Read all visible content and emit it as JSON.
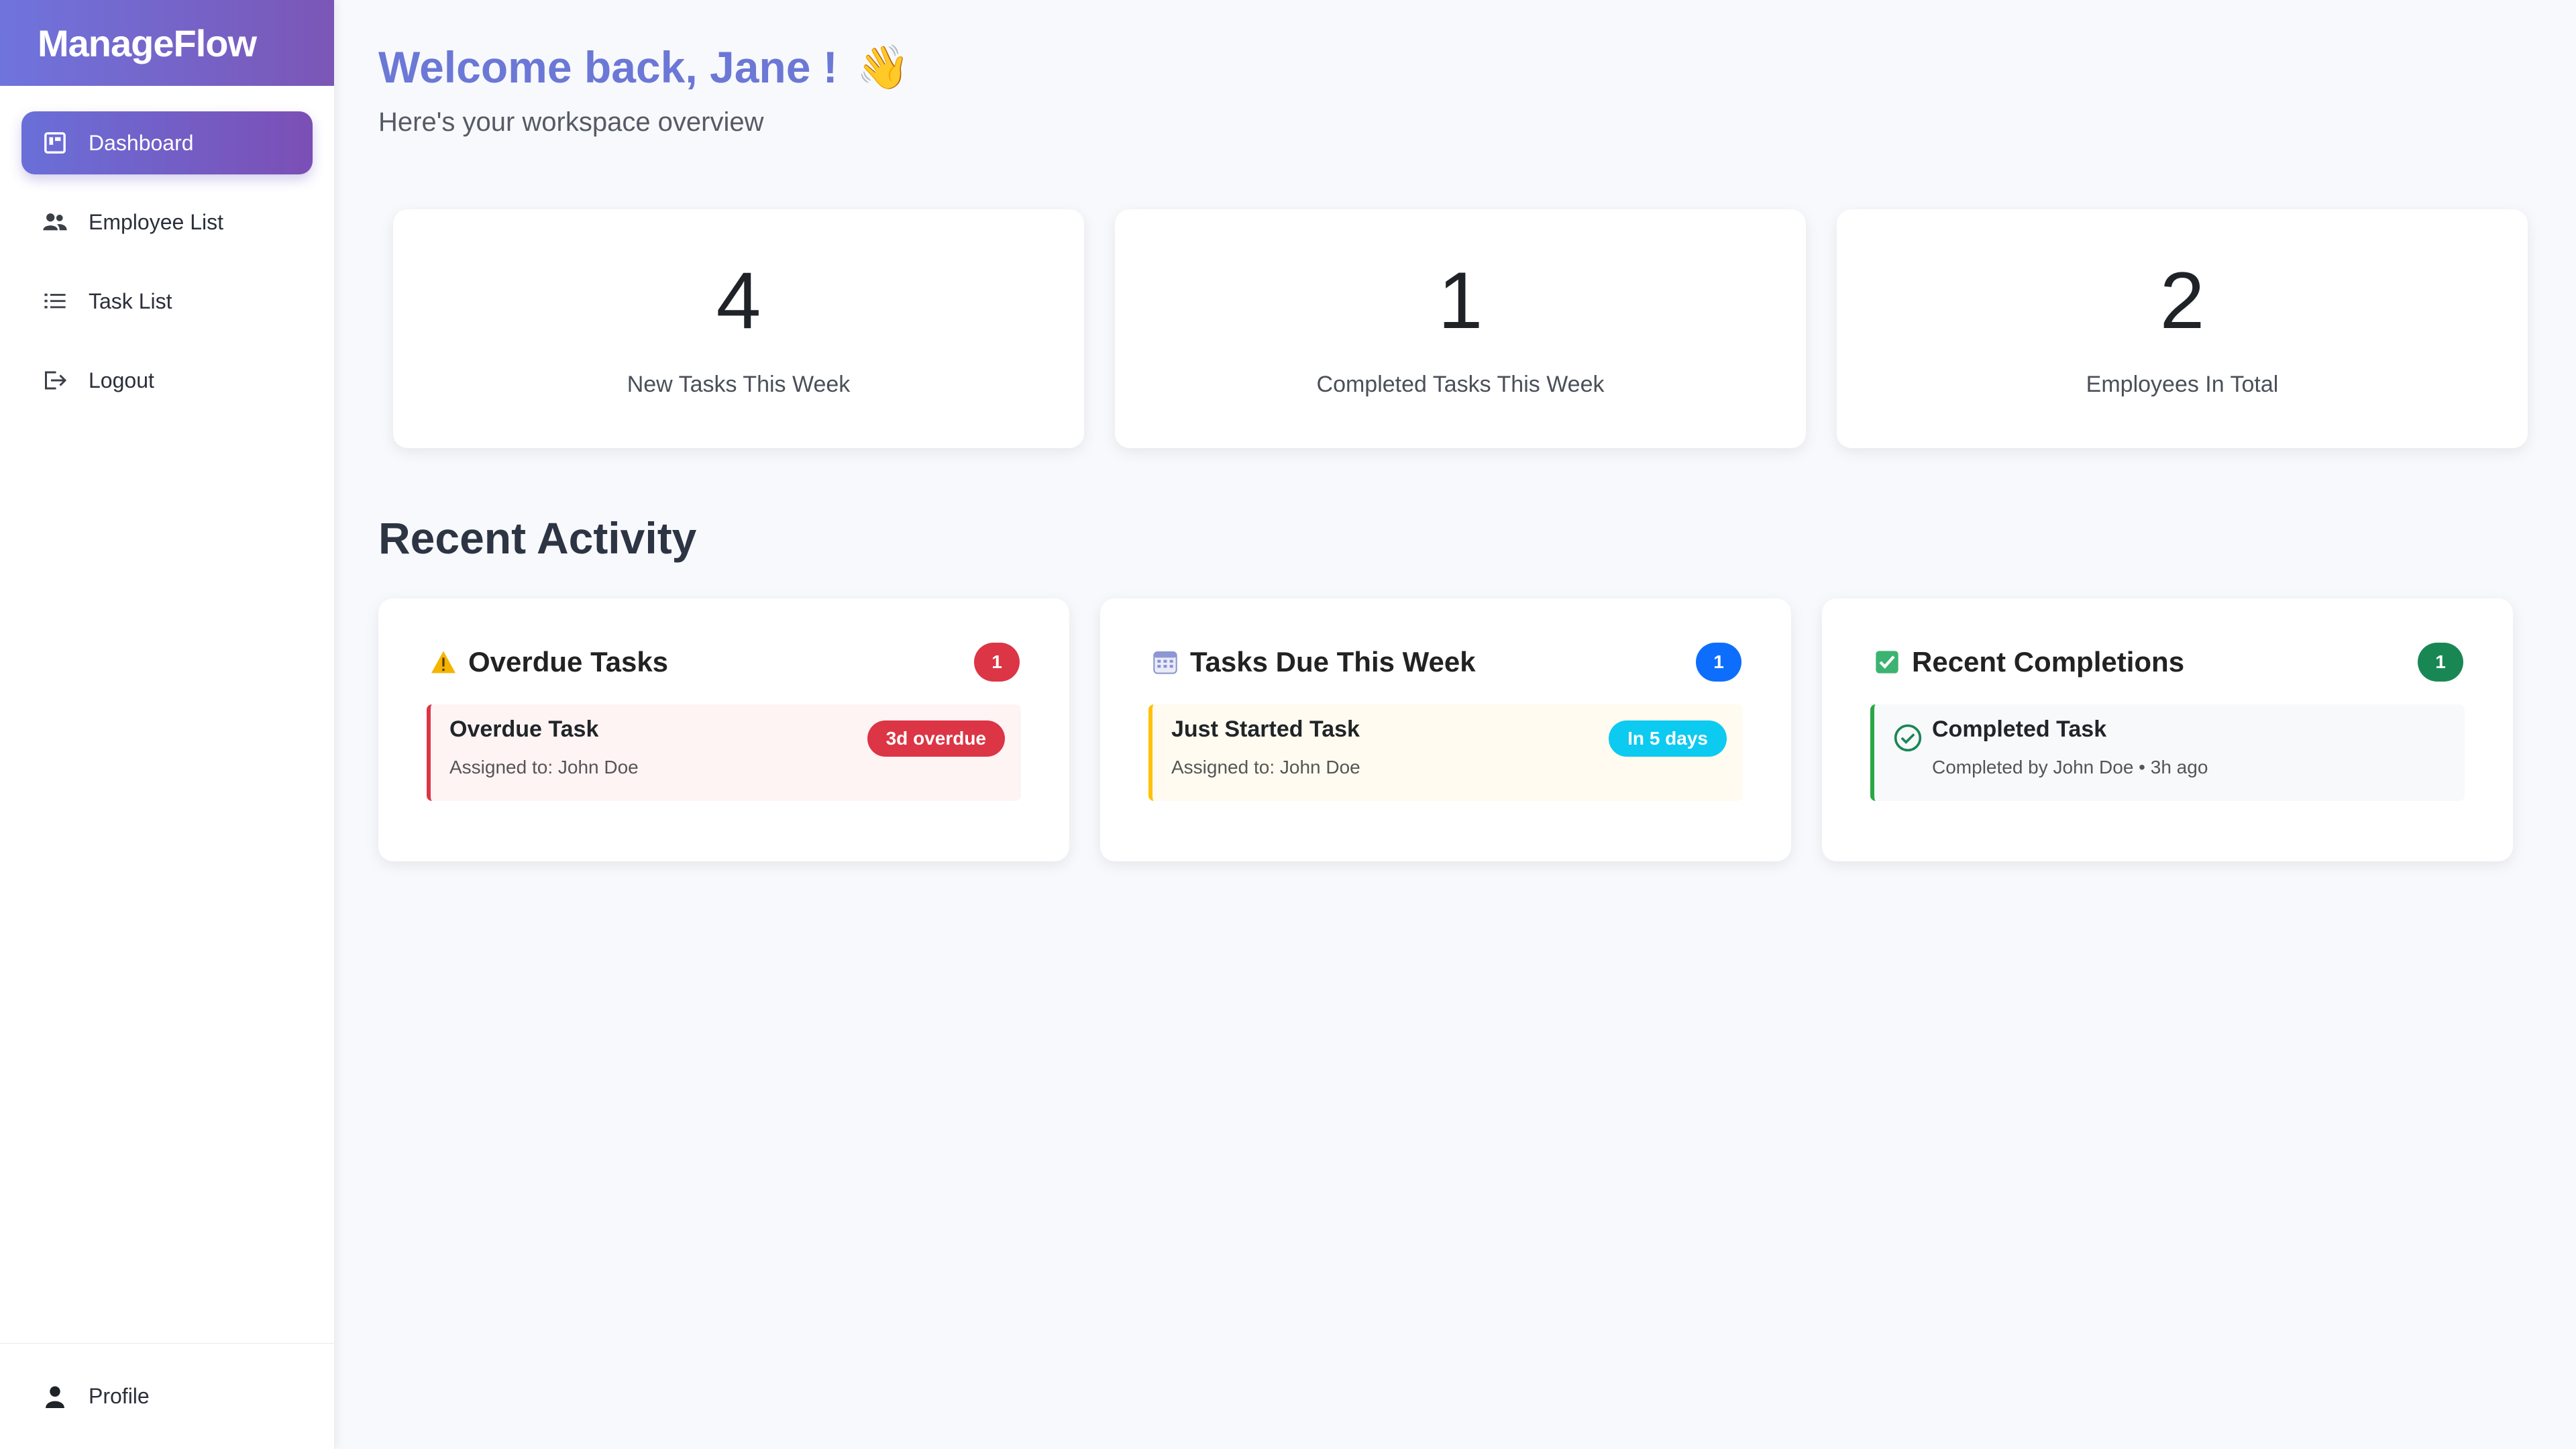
{
  "app": {
    "brand": "ManageFlow"
  },
  "sidebar": {
    "items": [
      {
        "label": "Dashboard",
        "icon": "dashboard-icon",
        "active": true
      },
      {
        "label": "Employee List",
        "icon": "users-icon",
        "active": false
      },
      {
        "label": "Task List",
        "icon": "list-icon",
        "active": false
      },
      {
        "label": "Logout",
        "icon": "logout-icon",
        "active": false
      }
    ],
    "footer": {
      "label": "Profile",
      "icon": "person-icon"
    }
  },
  "header": {
    "title": "Welcome back, Jane !",
    "wave": "👋",
    "subtitle": "Here's your workspace overview"
  },
  "stats": [
    {
      "value": "4",
      "label": "New Tasks This Week"
    },
    {
      "value": "1",
      "label": "Completed Tasks This Week"
    },
    {
      "value": "2",
      "label": "Employees In Total"
    }
  ],
  "recent_activity": {
    "title": "Recent Activity",
    "cards": [
      {
        "title": "Overdue Tasks",
        "icon": "warning-icon",
        "count": "1",
        "count_color": "#dc3545",
        "item": {
          "title": "Overdue Task",
          "subtitle": "Assigned to: John Doe",
          "pill": "3d overdue",
          "pill_color": "#dc3545",
          "bg": "#fff4f4",
          "border": "#dc3545"
        }
      },
      {
        "title": "Tasks Due This Week",
        "icon": "calendar-icon",
        "count": "1",
        "count_color": "#0d6efd",
        "item": {
          "title": "Just Started Task",
          "subtitle": "Assigned to: John Doe",
          "pill": "In 5 days",
          "pill_color": "#0dcaf0",
          "bg": "#fffbf0",
          "border": "#ffc107"
        }
      },
      {
        "title": "Recent Completions",
        "icon": "check-square-icon",
        "count": "1",
        "count_color": "#198754",
        "item": {
          "title": "Completed Task",
          "subtitle": "Completed by John Doe • 3h ago",
          "bg": "#f8f9fa",
          "border": "#28a745"
        }
      }
    ]
  },
  "colors": {
    "accent": "#6c78d6",
    "brand_gradient_start": "#6f74dd",
    "brand_gradient_end": "#7b56b6"
  }
}
